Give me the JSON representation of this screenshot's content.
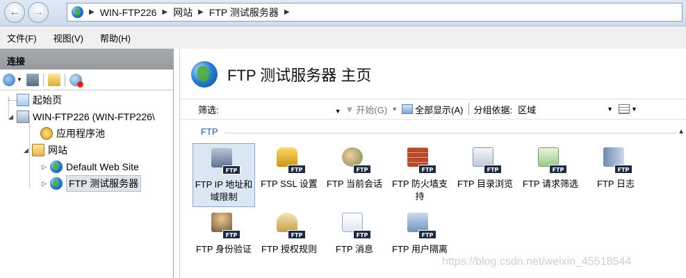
{
  "address_bar": {
    "crumbs": [
      "WIN-FTP226",
      "网站",
      "FTP 测试服务器"
    ]
  },
  "menu": {
    "items": [
      "文件(F)",
      "视图(V)",
      "帮助(H)"
    ]
  },
  "connections": {
    "title": "连接",
    "tree": [
      {
        "label": "起始页",
        "icon": "start-page-icon"
      },
      {
        "label": "WIN-FTP226 (WIN-FTP226\\",
        "icon": "server-icon",
        "expanded": true
      },
      {
        "label": "应用程序池",
        "icon": "app-pool-icon"
      },
      {
        "label": "网站",
        "icon": "sites-folder-icon",
        "expanded": true
      },
      {
        "label": "Default Web Site",
        "icon": "globe-icon"
      },
      {
        "label": "FTP 测试服务器",
        "icon": "globe-icon",
        "selected": true
      }
    ]
  },
  "main": {
    "title": "FTP 测试服务器 主页",
    "filter": {
      "label": "筛选:",
      "value": "",
      "start_label": "开始(G)",
      "show_all_label": "全部显示(A)",
      "group_by_label": "分组依据:",
      "group_by_value": "区域"
    },
    "section_label": "FTP",
    "features": [
      {
        "label": "FTP IP 地址和域限制",
        "icon": "ip-restrictions-icon",
        "selected": true
      },
      {
        "label": "FTP SSL 设置",
        "icon": "ssl-lock-icon"
      },
      {
        "label": "FTP 当前会话",
        "icon": "sessions-icon"
      },
      {
        "label": "FTP 防火墙支持",
        "icon": "firewall-icon"
      },
      {
        "label": "FTP 目录浏览",
        "icon": "directory-browsing-icon"
      },
      {
        "label": "FTP 请求筛选",
        "icon": "request-filtering-icon"
      },
      {
        "label": "FTP 日志",
        "icon": "logging-icon"
      },
      {
        "label": "FTP 身份验证",
        "icon": "authentication-icon"
      },
      {
        "label": "FTP 授权规则",
        "icon": "authorization-icon"
      },
      {
        "label": "FTP 消息",
        "icon": "messages-icon"
      },
      {
        "label": "FTP 用户隔离",
        "icon": "user-isolation-icon"
      }
    ],
    "badge_text": "FTP"
  },
  "watermark": "https://blog.csdn.net/weixin_45518544",
  "colors": {
    "section_label": "#1e5aa8",
    "selected_bg": "#dbe6f3",
    "panel_header": "#a0a3a6"
  }
}
